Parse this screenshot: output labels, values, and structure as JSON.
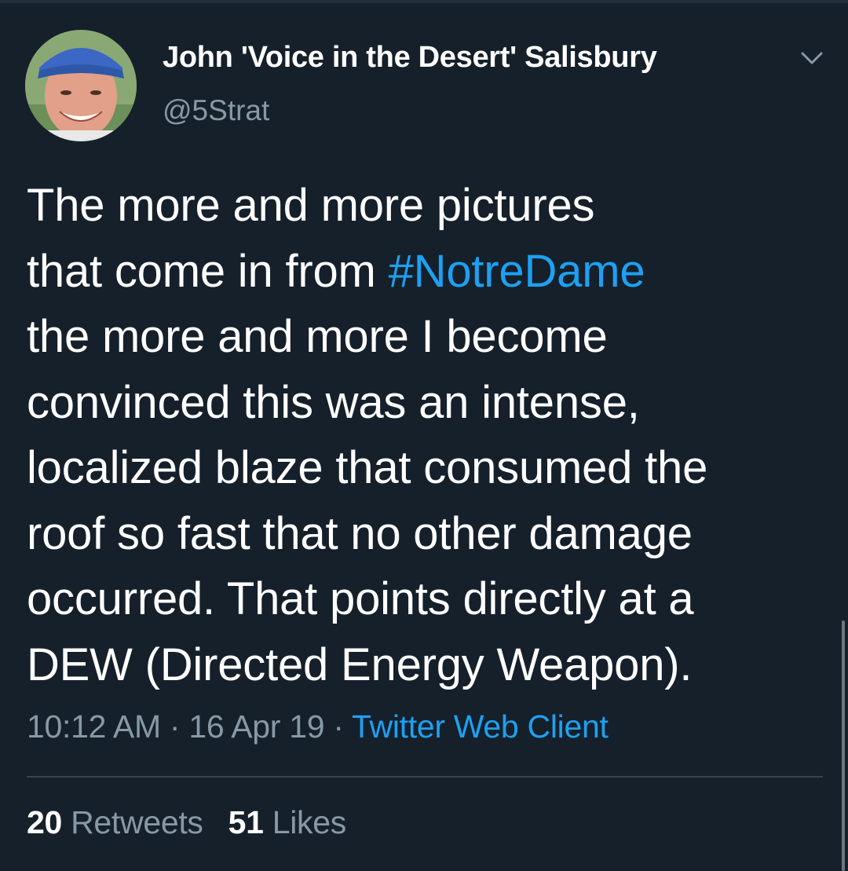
{
  "tweet": {
    "author_name": "John 'Voice in the Desert' Salisbury",
    "author_handle": "@5Strat",
    "text_lines": {
      "l1": "The more and more pictures",
      "l2_pre": "that come in from ",
      "l2_hashtag": "#NotreDame",
      "l3": "the more and more I become",
      "l4": "convinced this was an intense,",
      "l5": "localized blaze that consumed the",
      "l6": "roof so fast that no other damage",
      "l7": "occurred. That points directly at a",
      "l8": "DEW (Directed Energy Weapon)."
    },
    "time": "10:12 AM",
    "sep1": " · ",
    "date": "16 Apr 19",
    "sep2": " · ",
    "source": "Twitter Web Client",
    "retweets_count": "20",
    "retweets_label": "Retweets",
    "likes_count": "51",
    "likes_label": "Likes"
  },
  "icons": {
    "menu": "chevron-down-icon",
    "avatar": "avatar-photo"
  },
  "colors": {
    "background": "#15202b",
    "text": "#ffffff",
    "secondary_text": "#8899a6",
    "link": "#1da1f2",
    "divider": "#38444d"
  }
}
